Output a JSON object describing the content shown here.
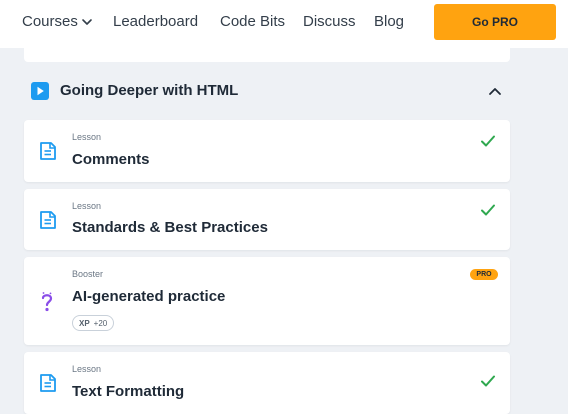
{
  "nav": {
    "items": [
      {
        "label": "Courses"
      },
      {
        "label": "Leaderboard"
      },
      {
        "label": "Code Bits"
      },
      {
        "label": "Discuss"
      },
      {
        "label": "Blog"
      }
    ],
    "cta_label": "Go PRO"
  },
  "section": {
    "title": "Going Deeper with HTML"
  },
  "cards": [
    {
      "type": "Lesson",
      "title": "Comments",
      "completed": true
    },
    {
      "type": "Lesson",
      "title": "Standards & Best Practices",
      "completed": true
    },
    {
      "type": "Booster",
      "title": "AI-generated practice",
      "badge": "PRO",
      "xp_label": "XP",
      "xp_value": "+20",
      "completed": false
    },
    {
      "type": "Lesson",
      "title": "Text Formatting",
      "completed": true
    }
  ],
  "colors": {
    "accent": "#ffa310",
    "brand_blue": "#1d9bf0",
    "check_green": "#2fa84f",
    "booster_purple": "#8a4de8"
  },
  "icons": {
    "play": "play-icon",
    "collapse": "chevron-up-icon",
    "lesson": "document-icon",
    "done": "check-icon",
    "booster": "question-mark-icon"
  }
}
